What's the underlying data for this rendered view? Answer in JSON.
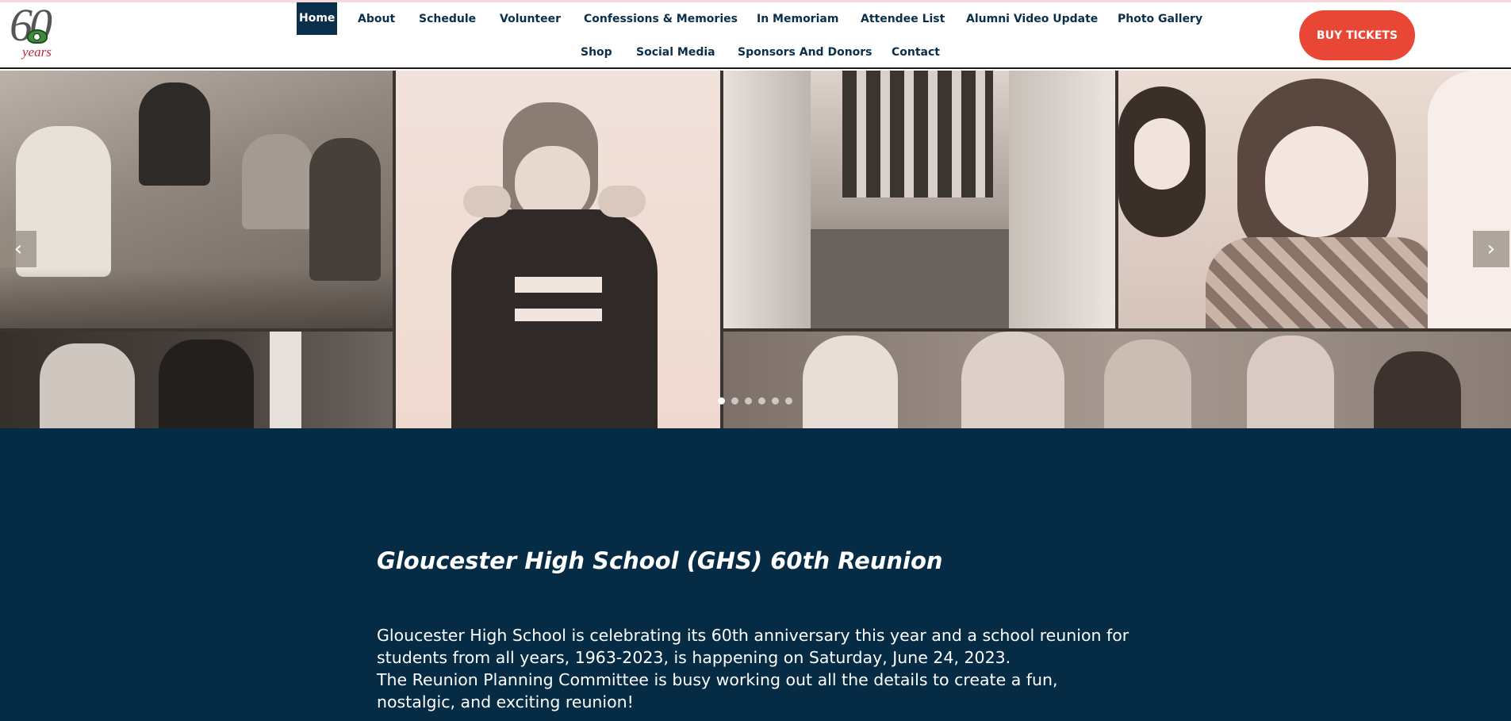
{
  "logo": {
    "number": "60",
    "word": "years"
  },
  "nav": {
    "row1": [
      "Home",
      "About",
      "Schedule",
      "Volunteer",
      "Confessions & Memories",
      "In Memoriam",
      "Attendee List",
      "Alumni Video Update",
      "Photo Gallery"
    ],
    "row2": [
      "Shop",
      "Social Media",
      "Sponsors And Donors",
      "Contact"
    ],
    "active": "Home"
  },
  "cta": {
    "label": "BUY TICKETS",
    "color": "#e84735"
  },
  "slider": {
    "prev_icon": "chevron-left-icon",
    "next_icon": "chevron-right-icon",
    "slide_count": 6,
    "current_slide": 1
  },
  "colors": {
    "navy": "#062c45",
    "nav_text": "#0a2f4a",
    "accent": "#e84735"
  },
  "main": {
    "title": "Gloucester High School (GHS) 60th Reunion",
    "paragraph1": "Gloucester High School is celebrating its 60th anniversary this year and a school reunion for students from all years, 1963-2023, is happening on Saturday, June 24, 2023.",
    "paragraph2": "The Reunion Planning Committee is busy working out all the details to create a fun, nostalgic, and exciting reunion!"
  }
}
